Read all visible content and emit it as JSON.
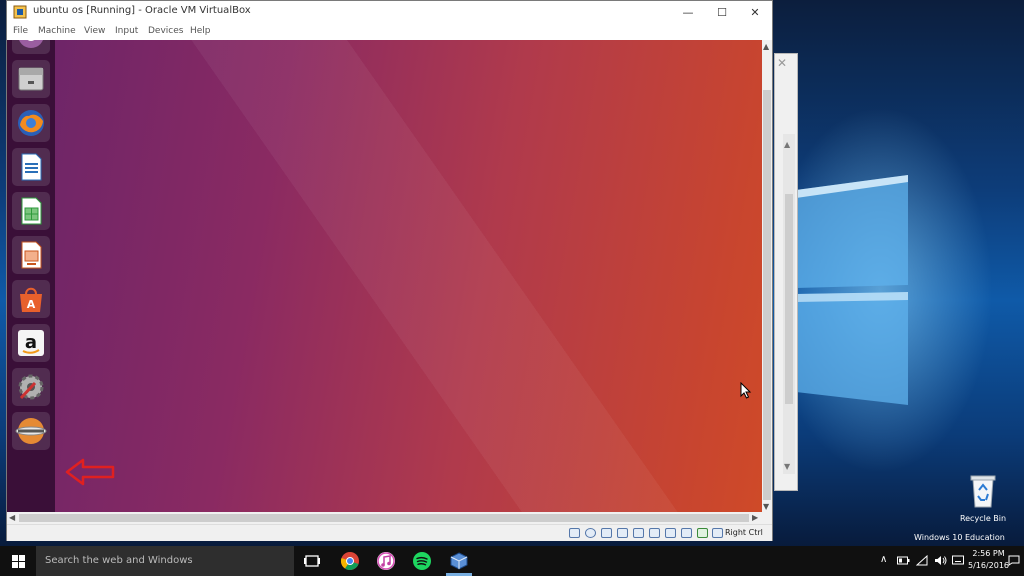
{
  "vm_window": {
    "title": "ubuntu os [Running] - Oracle VM VirtualBox",
    "minimize": "—",
    "maximize": "☐",
    "close": "✕",
    "menu": [
      "File",
      "Machine",
      "View",
      "Input",
      "Devices",
      "Help"
    ],
    "host_key": "Right Ctrl"
  },
  "launcher": {
    "items": [
      {
        "name": "dash",
        "icon": "ubuntu-dash-icon"
      },
      {
        "name": "files",
        "icon": "file-cabinet-icon"
      },
      {
        "name": "firefox",
        "icon": "firefox-icon"
      },
      {
        "name": "writer",
        "icon": "libreoffice-writer-icon"
      },
      {
        "name": "calc",
        "icon": "libreoffice-calc-icon"
      },
      {
        "name": "impress",
        "icon": "libreoffice-impress-icon"
      },
      {
        "name": "software-center",
        "icon": "software-center-icon"
      },
      {
        "name": "amazon",
        "icon": "amazon-icon"
      },
      {
        "name": "system-settings",
        "icon": "settings-icon"
      },
      {
        "name": "disk-installer",
        "icon": "disc-drive-icon"
      }
    ]
  },
  "desktop": {
    "recycle_bin_label": "Recycle Bin",
    "windows_edition": "Windows 10 Education"
  },
  "taskbar": {
    "search_placeholder": "Search the web and Windows",
    "time": "2:56 PM",
    "date": "5/16/2016",
    "apps": [
      "task-view-icon",
      "chrome-icon",
      "itunes-icon",
      "spotify-icon",
      "virtualbox-icon"
    ]
  },
  "colors": {
    "ubuntu_launcher": "#3a0f38",
    "ubuntu_wallpaper_left": "#6e2568",
    "ubuntu_wallpaper_right": "#cf4a28",
    "annotation_arrow": "#e02020",
    "taskbar": "#101010"
  }
}
